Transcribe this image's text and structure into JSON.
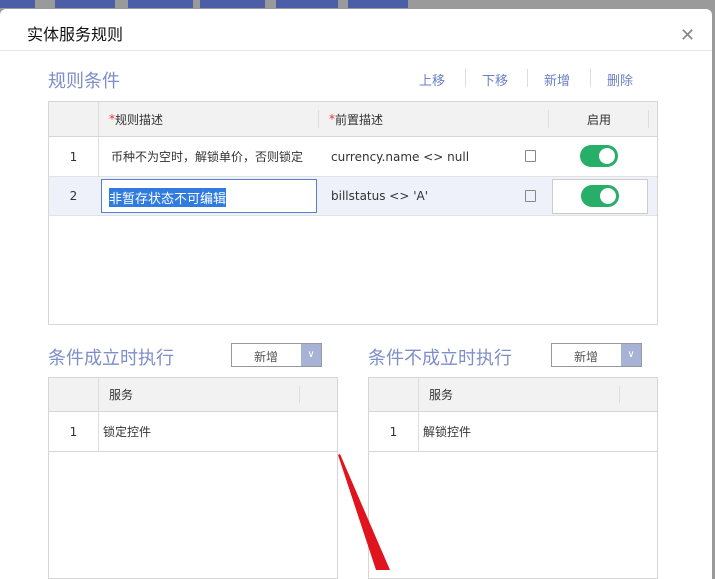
{
  "dialog": {
    "title": "实体服务规则",
    "close_icon": "close-icon"
  },
  "rules": {
    "title": "规则条件",
    "actions": [
      "上移",
      "下移",
      "新增",
      "删除"
    ],
    "headers": {
      "desc": "规则描述",
      "pre": "前置描述",
      "enable": "启用",
      "required_mark": "*"
    },
    "rows": [
      {
        "index": "1",
        "desc": "币种不为空时，解锁单价，否则锁定",
        "pre": "currency.name  <> null",
        "enabled": true
      },
      {
        "index": "2",
        "desc": "非暂存状态不可编辑",
        "pre": "billstatus <> 'A'",
        "enabled": true
      }
    ]
  },
  "true_exec": {
    "title": "条件成立时执行",
    "add": "新增",
    "header": "服务",
    "rows": [
      {
        "index": "1",
        "service": "锁定控件"
      }
    ]
  },
  "false_exec": {
    "title": "条件不成立时执行",
    "add": "新增",
    "header": "服务",
    "rows": [
      {
        "index": "1",
        "service": "解锁控件"
      }
    ]
  },
  "colors": {
    "accent": "#7d8ec9",
    "toggle": "#27ae68",
    "annotation": "#e0141e"
  }
}
